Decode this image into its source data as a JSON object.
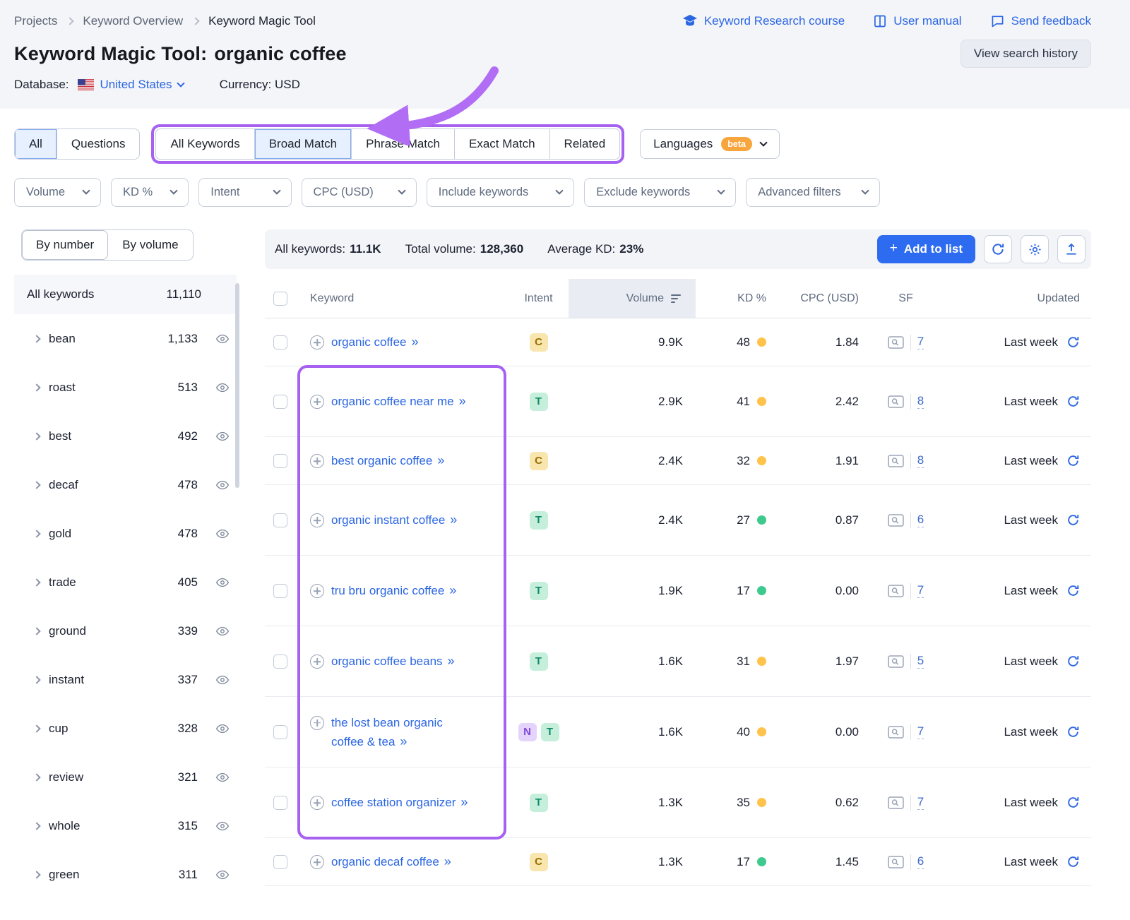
{
  "breadcrumb": {
    "items": [
      "Projects",
      "Keyword Overview",
      "Keyword Magic Tool"
    ]
  },
  "header_links": [
    {
      "label": "Keyword Research course",
      "icon": "graduation-cap-icon"
    },
    {
      "label": "User manual",
      "icon": "book-icon"
    },
    {
      "label": "Send feedback",
      "icon": "speech-bubble-icon"
    }
  ],
  "page": {
    "title": "Keyword Magic Tool:",
    "query": "organic coffee",
    "view_history": "View search history",
    "database_label": "Database:",
    "database_value": "United States",
    "currency_label": "Currency:",
    "currency_value": "USD"
  },
  "tabs": {
    "scope": [
      "All",
      "Questions"
    ],
    "match": [
      "All Keywords",
      "Broad Match",
      "Phrase Match",
      "Exact Match",
      "Related"
    ],
    "selected_scope": "All",
    "selected_match": "Broad Match",
    "languages": "Languages",
    "languages_badge": "beta"
  },
  "filters": [
    "Volume",
    "KD %",
    "Intent",
    "CPC (USD)",
    "Include keywords",
    "Exclude keywords",
    "Advanced filters"
  ],
  "sidebar": {
    "toggle": [
      "By number",
      "By volume"
    ],
    "all_row": {
      "label": "All keywords",
      "count": "11,110"
    },
    "groups": [
      {
        "label": "bean",
        "count": "1,133"
      },
      {
        "label": "roast",
        "count": "513"
      },
      {
        "label": "best",
        "count": "492"
      },
      {
        "label": "decaf",
        "count": "478"
      },
      {
        "label": "gold",
        "count": "478"
      },
      {
        "label": "trade",
        "count": "405"
      },
      {
        "label": "ground",
        "count": "339"
      },
      {
        "label": "instant",
        "count": "337"
      },
      {
        "label": "cup",
        "count": "328"
      },
      {
        "label": "review",
        "count": "321"
      },
      {
        "label": "whole",
        "count": "315"
      },
      {
        "label": "green",
        "count": "311"
      }
    ]
  },
  "summary": {
    "all_keywords_label": "All keywords:",
    "all_keywords": "11.1K",
    "total_volume_label": "Total volume:",
    "total_volume": "128,360",
    "avg_kd_label": "Average KD:",
    "avg_kd": "23%",
    "add_to_list": "Add to list"
  },
  "table": {
    "columns": [
      "Keyword",
      "Intent",
      "Volume",
      "KD %",
      "CPC (USD)",
      "SF",
      "Updated"
    ],
    "rows": [
      {
        "keyword": "organic coffee",
        "intents": [
          {
            "label": "C",
            "type": "commercial"
          }
        ],
        "volume": "9.9K",
        "kd": "48",
        "kd_level": "medium",
        "cpc": "1.84",
        "sf": "7",
        "updated": "Last week"
      },
      {
        "keyword": "organic coffee near me",
        "intents": [
          {
            "label": "T",
            "type": "transactional"
          }
        ],
        "volume": "2.9K",
        "kd": "41",
        "kd_level": "medium",
        "cpc": "2.42",
        "sf": "8",
        "updated": "Last week"
      },
      {
        "keyword": "best organic coffee",
        "intents": [
          {
            "label": "C",
            "type": "commercial"
          }
        ],
        "volume": "2.4K",
        "kd": "32",
        "kd_level": "medium",
        "cpc": "1.91",
        "sf": "8",
        "updated": "Last week"
      },
      {
        "keyword": "organic instant coffee",
        "intents": [
          {
            "label": "T",
            "type": "transactional"
          }
        ],
        "volume": "2.4K",
        "kd": "27",
        "kd_level": "easy",
        "cpc": "0.87",
        "sf": "6",
        "updated": "Last week"
      },
      {
        "keyword": "tru bru organic coffee",
        "intents": [
          {
            "label": "T",
            "type": "transactional"
          }
        ],
        "volume": "1.9K",
        "kd": "17",
        "kd_level": "easy",
        "cpc": "0.00",
        "sf": "7",
        "updated": "Last week"
      },
      {
        "keyword": "organic coffee beans",
        "intents": [
          {
            "label": "T",
            "type": "transactional"
          }
        ],
        "volume": "1.6K",
        "kd": "31",
        "kd_level": "medium",
        "cpc": "1.97",
        "sf": "5",
        "updated": "Last week"
      },
      {
        "keyword": "the lost bean organic coffee & tea",
        "intents": [
          {
            "label": "N",
            "type": "navigational"
          },
          {
            "label": "T",
            "type": "transactional"
          }
        ],
        "volume": "1.6K",
        "kd": "40",
        "kd_level": "medium",
        "cpc": "0.00",
        "sf": "7",
        "updated": "Last week"
      },
      {
        "keyword": "coffee station organizer",
        "intents": [
          {
            "label": "T",
            "type": "transactional"
          }
        ],
        "volume": "1.3K",
        "kd": "35",
        "kd_level": "medium",
        "cpc": "0.62",
        "sf": "7",
        "updated": "Last week"
      },
      {
        "keyword": "organic decaf coffee",
        "intents": [
          {
            "label": "C",
            "type": "commercial"
          }
        ],
        "volume": "1.3K",
        "kd": "17",
        "kd_level": "easy",
        "cpc": "1.45",
        "sf": "6",
        "updated": "Last week"
      }
    ]
  },
  "colors": {
    "annotation_purple": "#a661f1",
    "brand_blue": "#2b66e3",
    "kd_medium": "#ffc24a",
    "kd_easy": "#3ec98e"
  },
  "icons": {
    "sf_icon": "serp-preview-icon",
    "row_refresh": "refresh-icon",
    "toolbar": [
      "refresh-icon",
      "gear-icon",
      "export-icon"
    ]
  }
}
